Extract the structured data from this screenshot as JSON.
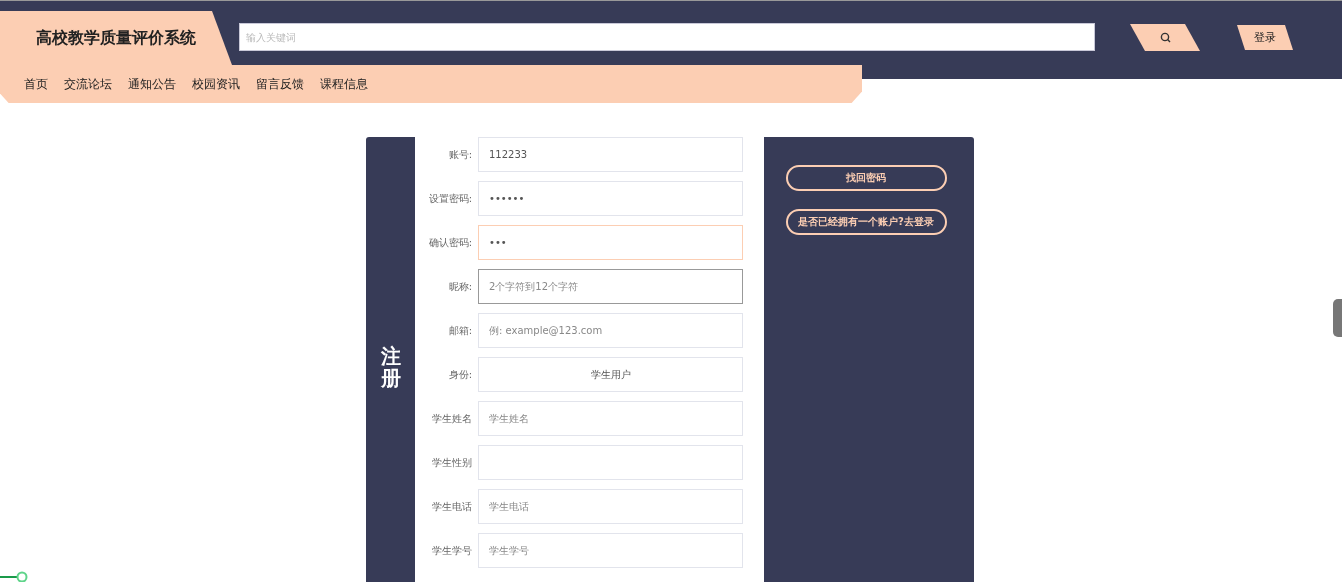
{
  "header": {
    "site_title": "高校教学质量评价系统",
    "search": {
      "placeholder": "输入关键词"
    },
    "login_button": "登录"
  },
  "nav": {
    "items": [
      {
        "label": "首页"
      },
      {
        "label": "交流论坛"
      },
      {
        "label": "通知公告"
      },
      {
        "label": "校园资讯"
      },
      {
        "label": "留言反馈"
      },
      {
        "label": "课程信息"
      }
    ]
  },
  "register": {
    "title": "注册",
    "fields": [
      {
        "label": "账号:",
        "kind": "text",
        "value": "112233",
        "focused": false,
        "hovered": false
      },
      {
        "label": "设置密码:",
        "kind": "text",
        "value": "••••••",
        "focused": false,
        "hovered": false
      },
      {
        "label": "确认密码:",
        "kind": "text",
        "value": "•••",
        "focused": true,
        "hovered": false
      },
      {
        "label": "昵称:",
        "kind": "text",
        "placeholder": "2个字符到12个字符",
        "focused": false,
        "hovered": true
      },
      {
        "label": "邮箱:",
        "kind": "text",
        "placeholder": "例: example@123.com",
        "focused": false,
        "hovered": false
      },
      {
        "label": "身份:",
        "kind": "select",
        "value": "学生用户",
        "focused": false,
        "hovered": false
      },
      {
        "label": "学生姓名",
        "kind": "text",
        "placeholder": "学生姓名",
        "focused": false,
        "hovered": false
      },
      {
        "label": "学生性别",
        "kind": "select",
        "focused": false,
        "hovered": false
      },
      {
        "label": "学生电话",
        "kind": "text",
        "placeholder": "学生电话",
        "focused": false,
        "hovered": false
      },
      {
        "label": "学生学号",
        "kind": "text",
        "placeholder": "学生学号",
        "focused": false,
        "hovered": false
      }
    ],
    "links": [
      {
        "text": "找回密码"
      },
      {
        "text": "是否已经拥有一个账户?去登录"
      }
    ]
  }
}
